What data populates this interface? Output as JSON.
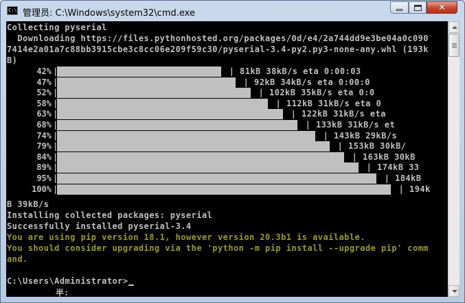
{
  "window": {
    "title": "管理员: C:\\Windows\\system32\\cmd.exe",
    "app_icon": "cmd-icon",
    "app_icon_text": "C:\\",
    "controls": [
      "minimize-icon",
      "maximize-icon",
      "close-icon"
    ],
    "close_glyph": "✕"
  },
  "console": {
    "lines_top": [
      "Collecting pyserial",
      "  Downloading https://files.pythonhosted.org/packages/0d/e4/2a744dd9e3be04a0c090",
      "7414e2a01a7c88bb3915cbe3c8cc06e209f59c30/pyserial-3.4-py2.py3-none-any.whl (193k",
      "B)"
    ],
    "progress": [
      {
        "pct": "42%",
        "fraction": 0.42,
        "rate": "| 81kB 38kB/s eta 0:00:03"
      },
      {
        "pct": "47%",
        "fraction": 0.47,
        "rate": "| 92kB 34kB/s eta 0:00:0"
      },
      {
        "pct": "52%",
        "fraction": 0.52,
        "rate": "| 102kB 35kB/s eta 0:0"
      },
      {
        "pct": "58%",
        "fraction": 0.58,
        "rate": "| 112kB 31kB/s eta 0"
      },
      {
        "pct": "63%",
        "fraction": 0.63,
        "rate": "| 122kB 31kB/s eta"
      },
      {
        "pct": "68%",
        "fraction": 0.68,
        "rate": "| 133kB 31kB/s et"
      },
      {
        "pct": "74%",
        "fraction": 0.74,
        "rate": "| 143kB 29kB/s"
      },
      {
        "pct": "79%",
        "fraction": 0.79,
        "rate": "| 153kB 30kB/"
      },
      {
        "pct": "84%",
        "fraction": 0.84,
        "rate": "| 163kB 30kB"
      },
      {
        "pct": "89%",
        "fraction": 0.89,
        "rate": "| 174kB 33"
      },
      {
        "pct": "95%",
        "fraction": 0.95,
        "rate": "| 184kB"
      },
      {
        "pct": "100%",
        "fraction": 1.0,
        "rate": "| 194k"
      }
    ],
    "lines_bottom": [
      "B 39kB/s",
      "Installing collected packages: pyserial",
      "Successfully installed pyserial-3.4"
    ],
    "warning_lines": [
      "You are using pip version 18.1, however version 20.3b1 is available.",
      "You should consider upgrading via the 'python -m pip install --upgrade pip' comm",
      "and."
    ],
    "prompt": "C:\\Users\\Administrator>",
    "ime_indicator": "半:"
  },
  "colors": {
    "console_bg": "#000000",
    "console_text": "#c0c0c0",
    "warning_text": "#9a9a1c"
  }
}
